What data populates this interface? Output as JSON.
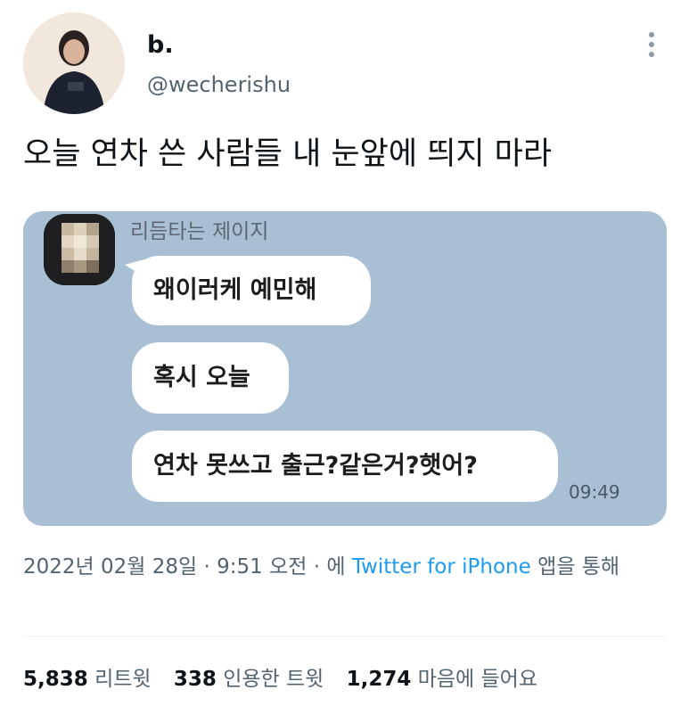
{
  "user": {
    "display_name": "b.",
    "handle": "@wecherishu"
  },
  "tweet": {
    "text": "오늘 연차 쓴 사람들 내 눈앞에 띄지 마라"
  },
  "chat": {
    "sender": "리듬타는 제이지",
    "messages": [
      "왜이러케 예민해",
      "혹시 오늘",
      "연차 못쓰고 출근?같은거?햇어?"
    ],
    "time": "09:49"
  },
  "meta": {
    "date": "2022년 02월 28일",
    "sep1": "·",
    "time": "9:51 오전",
    "sep2": "·",
    "prefix": "에",
    "source": "Twitter for iPhone",
    "suffix": "앱을 통해"
  },
  "stats": {
    "retweets_count": "5,838",
    "retweets_label": "리트윗",
    "quotes_count": "338",
    "quotes_label": "인용한 트윗",
    "likes_count": "1,274",
    "likes_label": "마음에 들어요"
  }
}
